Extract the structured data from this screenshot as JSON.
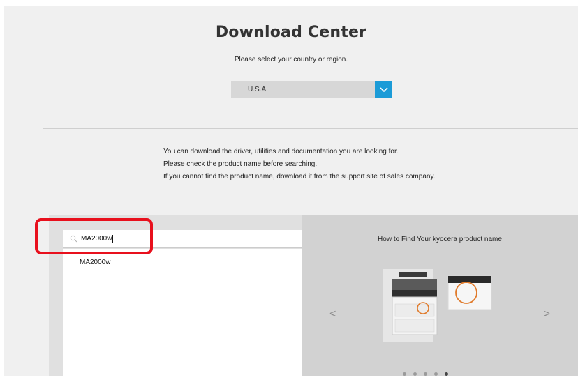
{
  "header": {
    "title": "Download Center",
    "subtitle": "Please select your country or region."
  },
  "country_select": {
    "value": "U.S.A.",
    "arrow_icon": "chevron-down-icon",
    "accent_color": "#1b9bd7"
  },
  "info": {
    "lines": [
      "You can download the driver, utilities and documentation you are looking for.",
      "Please check the product name before searching.",
      "If you cannot find the product name, download it from the support site of sales company."
    ]
  },
  "search": {
    "icon": "search-icon",
    "value": "MA2000w",
    "suggestions": [
      "MA2000w"
    ]
  },
  "help": {
    "title": "How to Find Your kyocera product name",
    "prev_icon": "chevron-left-icon",
    "next_icon": "chevron-right-icon",
    "prev_glyph": "<",
    "next_glyph": ">",
    "highlight_color": "#e8101d"
  }
}
